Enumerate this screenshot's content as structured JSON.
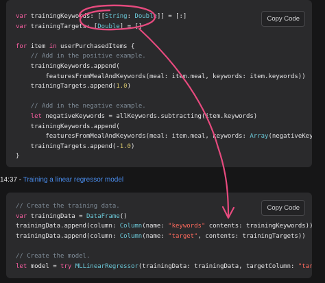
{
  "colors": {
    "background": "#161617",
    "code_background": "#2a2a2c",
    "keyword": "#fc5fa3",
    "type": "#6bc8d8",
    "comment": "#7f8c98",
    "string": "#fc6a5d",
    "number": "#d0bf69",
    "link": "#4a8ef0",
    "annotation": "#e64a7e"
  },
  "code_blocks": [
    {
      "copy_label": "Copy Code",
      "lines": [
        [
          [
            "kw",
            "var"
          ],
          [
            "",
            "trainingKeywords: [["
          ],
          [
            "ty",
            "String"
          ],
          [
            "",
            ": "
          ],
          [
            "ty",
            "Double"
          ],
          [
            "",
            "]] = [:]"
          ]
        ],
        [
          [
            "kw",
            "var"
          ],
          [
            "",
            "trainingTargets: ["
          ],
          [
            "ty",
            "Double"
          ],
          [
            "",
            "] = []"
          ]
        ],
        [],
        [
          [
            "kw",
            "for"
          ],
          [
            "",
            "item "
          ],
          [
            "kw",
            "in"
          ],
          [
            "",
            "userPurchasedItems {"
          ]
        ],
        [
          [
            "",
            "    "
          ],
          [
            "cm",
            "// Add in the positive example."
          ]
        ],
        [
          [
            "",
            "    trainingKeywords.append("
          ]
        ],
        [
          [
            "",
            "        featuresFromMealAndKeywords(meal: item.meal, keywords: item.keywords))"
          ]
        ],
        [
          [
            "",
            "    trainingTargets.append("
          ],
          [
            "nm",
            "1.0"
          ],
          [
            "",
            ")"
          ]
        ],
        [],
        [
          [
            "",
            "    "
          ],
          [
            "cm",
            "// Add in the negative example."
          ]
        ],
        [
          [
            "",
            "    "
          ],
          [
            "kw",
            "let"
          ],
          [
            "",
            "negativeKeywords = allKeywords.subtracting(item.keywords)"
          ]
        ],
        [
          [
            "",
            "    trainingKeywords.append("
          ]
        ],
        [
          [
            "",
            "        featuresFromMealAndKeywords(meal: item.meal, keywords: "
          ],
          [
            "ty",
            "Array"
          ],
          [
            "",
            "(negativeKeywords)))"
          ]
        ],
        [
          [
            "",
            "    trainingTargets.append(-"
          ],
          [
            "nm",
            "1.0"
          ],
          [
            "",
            ")"
          ]
        ],
        [
          [
            "",
            "}"
          ]
        ]
      ]
    },
    {
      "copy_label": "Copy Code",
      "lines": [
        [
          [
            "cm",
            "// Create the training data."
          ]
        ],
        [
          [
            "kw",
            "var"
          ],
          [
            "",
            "trainingData = "
          ],
          [
            "ty",
            "DataFrame"
          ],
          [
            "",
            "()"
          ]
        ],
        [
          [
            "",
            "trainingData.append(column: "
          ],
          [
            "ty",
            "Column"
          ],
          [
            "",
            "(name: "
          ],
          [
            "st",
            "\"keywords\""
          ],
          [
            "",
            " contents: trainingKeywords))"
          ]
        ],
        [
          [
            "",
            "trainingData.append(column: "
          ],
          [
            "ty",
            "Column"
          ],
          [
            "",
            "(name: "
          ],
          [
            "st",
            "\"target\""
          ],
          [
            "",
            ", contents: trainingTargets))"
          ]
        ],
        [],
        [
          [
            "cm",
            "// Create the model."
          ]
        ],
        [
          [
            "kw",
            "let"
          ],
          [
            "",
            "model = "
          ],
          [
            "kw",
            "try"
          ],
          [
            "ty",
            "MLLinearRegressor"
          ],
          [
            "",
            "(trainingData: trainingData, targetColumn: "
          ],
          [
            "st",
            "\"target\""
          ],
          [
            "",
            ")"
          ]
        ]
      ]
    }
  ],
  "timestamp": {
    "time": "14:37",
    "separator": " - ",
    "chapter_title": "Training a linear regressor model"
  }
}
